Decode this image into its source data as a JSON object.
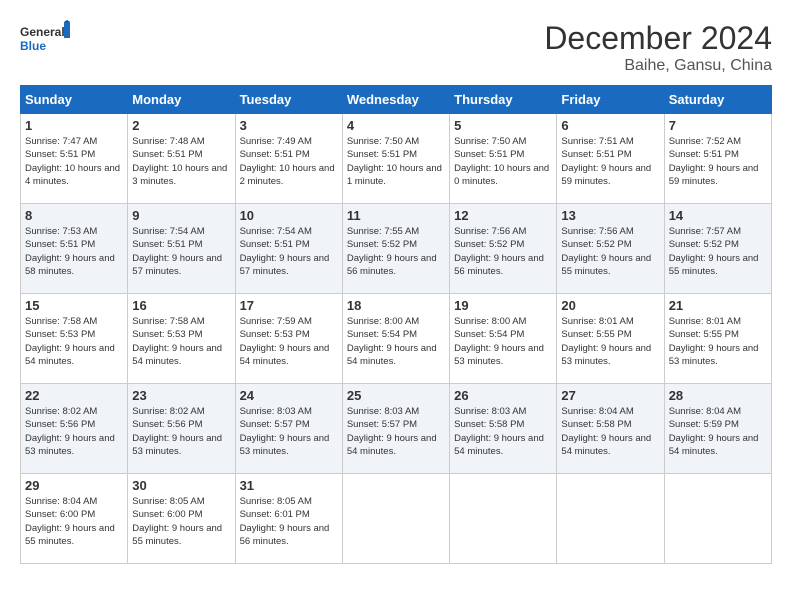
{
  "logo": {
    "line1": "General",
    "line2": "Blue"
  },
  "title": "December 2024",
  "subtitle": "Baihe, Gansu, China",
  "weekdays": [
    "Sunday",
    "Monday",
    "Tuesday",
    "Wednesday",
    "Thursday",
    "Friday",
    "Saturday"
  ],
  "weeks": [
    [
      {
        "day": "1",
        "sunrise": "7:47 AM",
        "sunset": "5:51 PM",
        "daylight": "10 hours and 4 minutes."
      },
      {
        "day": "2",
        "sunrise": "7:48 AM",
        "sunset": "5:51 PM",
        "daylight": "10 hours and 3 minutes."
      },
      {
        "day": "3",
        "sunrise": "7:49 AM",
        "sunset": "5:51 PM",
        "daylight": "10 hours and 2 minutes."
      },
      {
        "day": "4",
        "sunrise": "7:50 AM",
        "sunset": "5:51 PM",
        "daylight": "10 hours and 1 minute."
      },
      {
        "day": "5",
        "sunrise": "7:50 AM",
        "sunset": "5:51 PM",
        "daylight": "10 hours and 0 minutes."
      },
      {
        "day": "6",
        "sunrise": "7:51 AM",
        "sunset": "5:51 PM",
        "daylight": "9 hours and 59 minutes."
      },
      {
        "day": "7",
        "sunrise": "7:52 AM",
        "sunset": "5:51 PM",
        "daylight": "9 hours and 59 minutes."
      }
    ],
    [
      {
        "day": "8",
        "sunrise": "7:53 AM",
        "sunset": "5:51 PM",
        "daylight": "9 hours and 58 minutes."
      },
      {
        "day": "9",
        "sunrise": "7:54 AM",
        "sunset": "5:51 PM",
        "daylight": "9 hours and 57 minutes."
      },
      {
        "day": "10",
        "sunrise": "7:54 AM",
        "sunset": "5:51 PM",
        "daylight": "9 hours and 57 minutes."
      },
      {
        "day": "11",
        "sunrise": "7:55 AM",
        "sunset": "5:52 PM",
        "daylight": "9 hours and 56 minutes."
      },
      {
        "day": "12",
        "sunrise": "7:56 AM",
        "sunset": "5:52 PM",
        "daylight": "9 hours and 56 minutes."
      },
      {
        "day": "13",
        "sunrise": "7:56 AM",
        "sunset": "5:52 PM",
        "daylight": "9 hours and 55 minutes."
      },
      {
        "day": "14",
        "sunrise": "7:57 AM",
        "sunset": "5:52 PM",
        "daylight": "9 hours and 55 minutes."
      }
    ],
    [
      {
        "day": "15",
        "sunrise": "7:58 AM",
        "sunset": "5:53 PM",
        "daylight": "9 hours and 54 minutes."
      },
      {
        "day": "16",
        "sunrise": "7:58 AM",
        "sunset": "5:53 PM",
        "daylight": "9 hours and 54 minutes."
      },
      {
        "day": "17",
        "sunrise": "7:59 AM",
        "sunset": "5:53 PM",
        "daylight": "9 hours and 54 minutes."
      },
      {
        "day": "18",
        "sunrise": "8:00 AM",
        "sunset": "5:54 PM",
        "daylight": "9 hours and 54 minutes."
      },
      {
        "day": "19",
        "sunrise": "8:00 AM",
        "sunset": "5:54 PM",
        "daylight": "9 hours and 53 minutes."
      },
      {
        "day": "20",
        "sunrise": "8:01 AM",
        "sunset": "5:55 PM",
        "daylight": "9 hours and 53 minutes."
      },
      {
        "day": "21",
        "sunrise": "8:01 AM",
        "sunset": "5:55 PM",
        "daylight": "9 hours and 53 minutes."
      }
    ],
    [
      {
        "day": "22",
        "sunrise": "8:02 AM",
        "sunset": "5:56 PM",
        "daylight": "9 hours and 53 minutes."
      },
      {
        "day": "23",
        "sunrise": "8:02 AM",
        "sunset": "5:56 PM",
        "daylight": "9 hours and 53 minutes."
      },
      {
        "day": "24",
        "sunrise": "8:03 AM",
        "sunset": "5:57 PM",
        "daylight": "9 hours and 53 minutes."
      },
      {
        "day": "25",
        "sunrise": "8:03 AM",
        "sunset": "5:57 PM",
        "daylight": "9 hours and 54 minutes."
      },
      {
        "day": "26",
        "sunrise": "8:03 AM",
        "sunset": "5:58 PM",
        "daylight": "9 hours and 54 minutes."
      },
      {
        "day": "27",
        "sunrise": "8:04 AM",
        "sunset": "5:58 PM",
        "daylight": "9 hours and 54 minutes."
      },
      {
        "day": "28",
        "sunrise": "8:04 AM",
        "sunset": "5:59 PM",
        "daylight": "9 hours and 54 minutes."
      }
    ],
    [
      {
        "day": "29",
        "sunrise": "8:04 AM",
        "sunset": "6:00 PM",
        "daylight": "9 hours and 55 minutes."
      },
      {
        "day": "30",
        "sunrise": "8:05 AM",
        "sunset": "6:00 PM",
        "daylight": "9 hours and 55 minutes."
      },
      {
        "day": "31",
        "sunrise": "8:05 AM",
        "sunset": "6:01 PM",
        "daylight": "9 hours and 56 minutes."
      },
      null,
      null,
      null,
      null
    ]
  ]
}
